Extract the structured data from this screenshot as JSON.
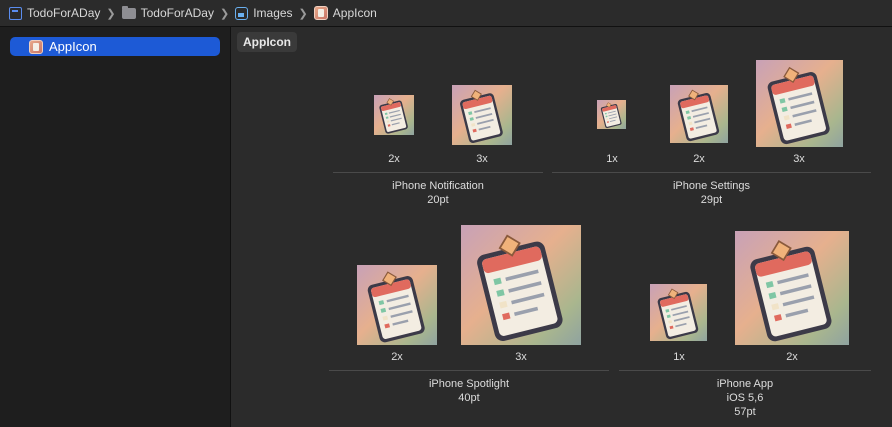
{
  "breadcrumb": {
    "items": [
      {
        "label": "TodoForADay",
        "icon": "project-icon"
      },
      {
        "label": "TodoForADay",
        "icon": "folder-icon"
      },
      {
        "label": "Images",
        "icon": "asset-catalog-icon"
      },
      {
        "label": "AppIcon",
        "icon": "appicon-icon"
      }
    ],
    "separator": "❯"
  },
  "sidebar": {
    "items": [
      {
        "label": "AppIcon",
        "selected": true
      }
    ]
  },
  "main": {
    "title": "AppIcon",
    "groups": [
      {
        "name": "iPhone Notification",
        "size": "20pt",
        "slots": [
          "2x",
          "3x"
        ]
      },
      {
        "name": "iPhone Settings",
        "size": "29pt",
        "slots": [
          "1x",
          "2x",
          "3x"
        ]
      },
      {
        "name": "iPhone Spotlight",
        "size": "40pt",
        "slots": [
          "2x",
          "3x"
        ]
      },
      {
        "name": "iPhone App",
        "subtitle": "iOS 5,6",
        "size": "57pt",
        "slots": [
          "1x",
          "2x"
        ]
      }
    ]
  },
  "colors": {
    "accent": "#1d5ad6",
    "sidebar_bg": "#1e1e1e",
    "editor_bg": "#2b2b2b"
  }
}
